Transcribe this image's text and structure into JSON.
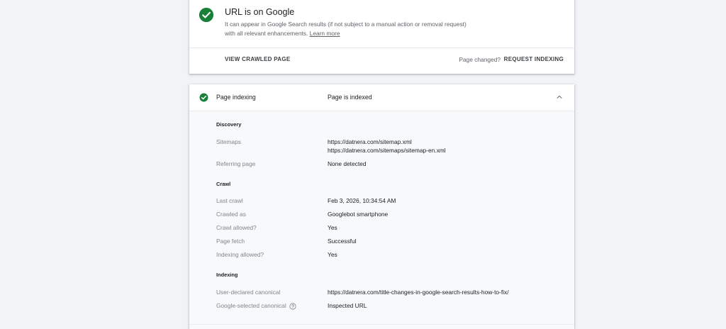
{
  "status_card": {
    "title": "URL is on Google",
    "description": "It can appear in Google Search results (if not subject to a manual action or removal request) with all relevant enhancements.",
    "learn_more": "Learn more",
    "view_crawled_page": "VIEW CRAWLED PAGE",
    "page_changed": "Page changed?",
    "request_indexing": "REQUEST INDEXING"
  },
  "indexing_card": {
    "label": "Page indexing",
    "value": "Page is indexed",
    "discovery": {
      "title": "Discovery",
      "sitemaps_label": "Sitemaps",
      "sitemaps": [
        "https://datnera.com/sitemap.xml",
        "https://datnera.com/sitemaps/sitemap-en.xml"
      ],
      "referring_page_label": "Referring page",
      "referring_page": "None detected"
    },
    "crawl": {
      "title": "Crawl",
      "last_crawl_label": "Last crawl",
      "last_crawl": "Feb 3, 2026, 10:34:54 AM",
      "crawled_as_label": "Crawled as",
      "crawled_as": "Googlebot smartphone",
      "crawl_allowed_label": "Crawl allowed?",
      "crawl_allowed": "Yes",
      "page_fetch_label": "Page fetch",
      "page_fetch": "Successful",
      "indexing_allowed_label": "Indexing allowed?",
      "indexing_allowed": "Yes"
    },
    "indexing": {
      "title": "Indexing",
      "user_canonical_label": "User-declared canonical",
      "user_canonical": "https://datnera.com/title-changes-in-google-search-results-how-to-fix/",
      "google_canonical_label": "Google-selected canonical",
      "google_canonical": "Inspected URL"
    }
  },
  "colors": {
    "success": "#188038",
    "background": "#f1f3f6",
    "card": "#ffffff",
    "muted_text": "#5f6368"
  },
  "icons": [
    "check-circle-icon",
    "chevron-up-icon",
    "help-icon"
  ]
}
